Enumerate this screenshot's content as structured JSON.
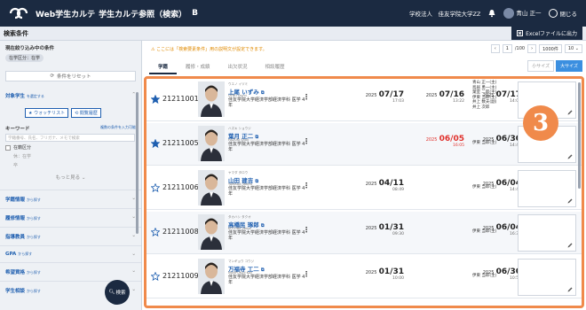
{
  "header": {
    "app_title": "Web学生カルテ",
    "app_sub": "学生カルテ参照（検索）",
    "app_mark": "B",
    "org": "学校法人　佳友学院大学ZZ",
    "user": "青山 正一",
    "close_label": "閉じる"
  },
  "subheader": {
    "title": "検索条件",
    "excel_label": "Excelファイルに出力"
  },
  "sidebar": {
    "current_filter_label": "現在絞り込み中の条件",
    "current_filter_chip": "在学区分：在学",
    "reset_label": "条件をリセット",
    "target_label": "対象学生",
    "target_hint": "を選定する",
    "watchlist_btn": "ウォッチリスト",
    "history_btn": "閲覧履歴",
    "keyword_label": "キーワード",
    "keyword_hint": "複数の条件を入力可能",
    "keyword_placeholder": "学籍番号、氏名、フリガナ、メモで検索",
    "enroll_label": "在籍区分",
    "enroll_opt1": "休：在学",
    "enroll_opt2": "卒",
    "more_label": "もっと見る",
    "sections": [
      {
        "label": "学籍情報",
        "hint": "から探す"
      },
      {
        "label": "履修情報",
        "hint": "から探す"
      },
      {
        "label": "指導教員",
        "hint": "から探す"
      },
      {
        "label": "GPA",
        "hint": "から探す"
      },
      {
        "label": "希望資格",
        "hint": "から探す"
      },
      {
        "label": "学生相談",
        "hint": "から探す"
      }
    ],
    "search_fab": "検索"
  },
  "main": {
    "notice": "ここには「検索要素条件」用の説明文が設定できます。",
    "pager_page": "1",
    "pager_total": "/100",
    "per_page": "1000件",
    "per_page2": "10",
    "tabs": [
      "学籍",
      "履修・成績",
      "出欠状況",
      "相談履歴"
    ],
    "view_small": "小サイズ",
    "view_large": "大サイズ",
    "badge": "3",
    "rows": [
      {
        "starred": true,
        "id": "21211001",
        "kana": "ウエノ イヅミ",
        "name": "上尾 いずみ",
        "roman": "UENO Izumi",
        "dept": "佳友学院大学経済学部経済学科 医学 4年",
        "d1y": "2025",
        "d1": "07/17",
        "d1t": "17:03",
        "d2y": "2025",
        "d2": "07/16",
        "d2t": "13:22",
        "d3y": "2025",
        "d3": "07/17",
        "d3t": "14:08",
        "teachers": [
          "青山 正一(主)",
          "鳥居 勇一(主)",
          "葉室 二郎(主)",
          "伊東 当郎(主)",
          "井上 数夫(副)",
          "井上 次郎"
        ],
        "red": false
      },
      {
        "starred": true,
        "id": "21211005",
        "kana": "ハズキ ショウジ",
        "name": "葉月 正二",
        "roman": "HAZUKI Shoji",
        "dept": "佳友学院大学経済学部経済学科 医学 4年",
        "d1y": "",
        "d1": "",
        "d1t": "",
        "d2y": "2025",
        "d2": "06/05",
        "d2t": "16:05",
        "d3y": "2025",
        "d3": "06/30",
        "d3t": "14:44",
        "teachers": [
          "伊東 当郎(主)"
        ],
        "red": true
      },
      {
        "starred": false,
        "id": "21211006",
        "kana": "ヤマダ タロウ",
        "name": "山田 建吉",
        "roman": "YAMADA Takeru",
        "dept": "佳友学院大学経済学部経済学科 医学 4年",
        "d1y": "2025",
        "d1": "04/11",
        "d1t": "08:49",
        "d2y": "",
        "d2": "",
        "d2t": "",
        "d3y": "2025",
        "d3": "06/04",
        "d3t": "14:46",
        "teachers": [
          "伊東 当郎(主)"
        ],
        "red": false
      },
      {
        "starred": false,
        "id": "21211008",
        "kana": "タカハシ タクオ",
        "name": "高橋民 琢郎",
        "roman": "KOTOBA Takuo",
        "dept": "佳友学院大学経済学部経済学科 医学 4年",
        "d1y": "2025",
        "d1": "01/31",
        "d1t": "09:30",
        "d2y": "",
        "d2": "",
        "d2t": "",
        "d3y": "2025",
        "d3": "06/04",
        "d3t": "16:35",
        "teachers": [
          "伊東 当郎(主)"
        ],
        "red": false
      },
      {
        "starred": false,
        "id": "21211009",
        "kana": "マンギョウ コウジ",
        "name": "万福寺 工二",
        "roman": "MANPUKUJI Koji",
        "dept": "佳友学院大学経済学部経済学科 医学 4年",
        "d1y": "2025",
        "d1": "01/31",
        "d1t": "10:00",
        "d2y": "",
        "d2": "",
        "d2t": "",
        "d3y": "2025",
        "d3": "06/30",
        "d3t": "10:53",
        "teachers": [
          "伊東 当郎(主)"
        ],
        "red": false
      }
    ]
  },
  "colors": {
    "navy": "#1b2a41",
    "accent": "#f08a4b",
    "link": "#1f5fb0",
    "red": "#e0302b"
  }
}
